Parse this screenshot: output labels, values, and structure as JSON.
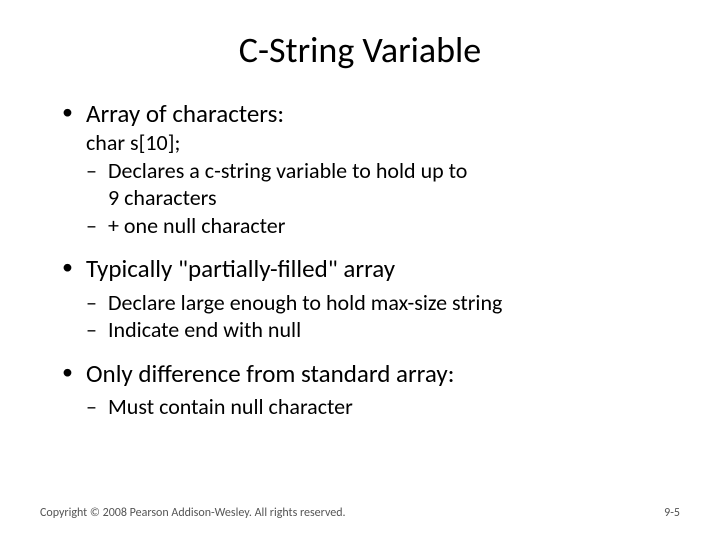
{
  "title": "C-String Variable",
  "bullets": {
    "b1": {
      "text": "Array of characters:",
      "code": "char s[10];",
      "s1a": "Declares a c-string variable to hold up to",
      "s1a_cont": "9 characters",
      "s1b": "+ one null character"
    },
    "b2": {
      "text": "Typically \"partially-filled\" array",
      "s2a": "Declare large enough to hold max-size string",
      "s2b": "Indicate end with null"
    },
    "b3": {
      "text": "Only difference from standard array:",
      "s3a": "Must contain null character"
    }
  },
  "footer": {
    "copyright": "Copyright © 2008 Pearson Addison-Wesley. All rights reserved.",
    "pagenum": "9-5"
  }
}
